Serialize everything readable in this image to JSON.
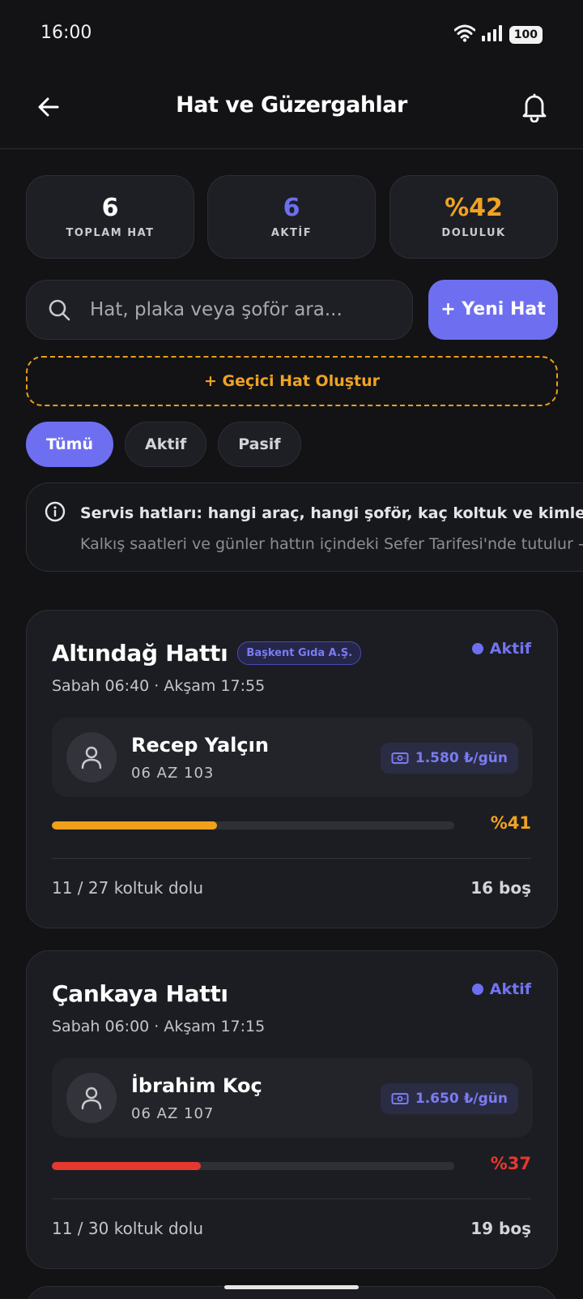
{
  "status_bar": {
    "time": "16:00",
    "battery": "100"
  },
  "header": {
    "title": "Hat ve Güzergahlar"
  },
  "stats": [
    {
      "value": "6",
      "label": "TOPLAM HAT",
      "color": "#ffffff"
    },
    {
      "value": "6",
      "label": "AKTİF",
      "color": "#6e6ff0"
    },
    {
      "value": "%42",
      "label": "DOLULUK",
      "color": "#f0a322"
    }
  ],
  "search": {
    "placeholder": "Hat, plaka veya şoför ara...",
    "value": ""
  },
  "buttons": {
    "new_line": "+ Yeni Hat",
    "temp_line": "+ Geçici Hat Oluştur"
  },
  "filters": [
    {
      "label": "Tümü",
      "active": true
    },
    {
      "label": "Aktif",
      "active": false
    },
    {
      "label": "Pasif",
      "active": false
    }
  ],
  "info": {
    "line1": "Servis hatları: hangi araç, hangi şoför, kaç koltuk ve kimlerin bi",
    "line2": "Kalkış saatleri ve günler hattın içindeki Sefer Tarifesi'nde tutulur -"
  },
  "routes": [
    {
      "name": "Altındağ Hattı",
      "company": "Başkent Gıda A.Ş.",
      "status": "Aktif",
      "times": "Sabah 06:40 · Akşam 17:55",
      "driver": "Recep Yalçın",
      "plate": "06  AZ  103",
      "fare": "1.580 ₺/gün",
      "occupancy_pct": "%41",
      "occupancy": 0.41,
      "bar_color": "#f0a01a",
      "pct_color": "#f0a322",
      "seats": "11 / 27 koltuk dolu",
      "empty": "16 boş"
    },
    {
      "name": "Çankaya Hattı",
      "company": "",
      "status": "Aktif",
      "times": "Sabah 06:00 · Akşam 17:15",
      "driver": "İbrahim Koç",
      "plate": "06  AZ  107",
      "fare": "1.650 ₺/gün",
      "occupancy_pct": "%37",
      "occupancy": 0.37,
      "bar_color": "#e5392f",
      "pct_color": "#e5392f",
      "seats": "11 / 30 koltuk dolu",
      "empty": "19 boş"
    }
  ]
}
